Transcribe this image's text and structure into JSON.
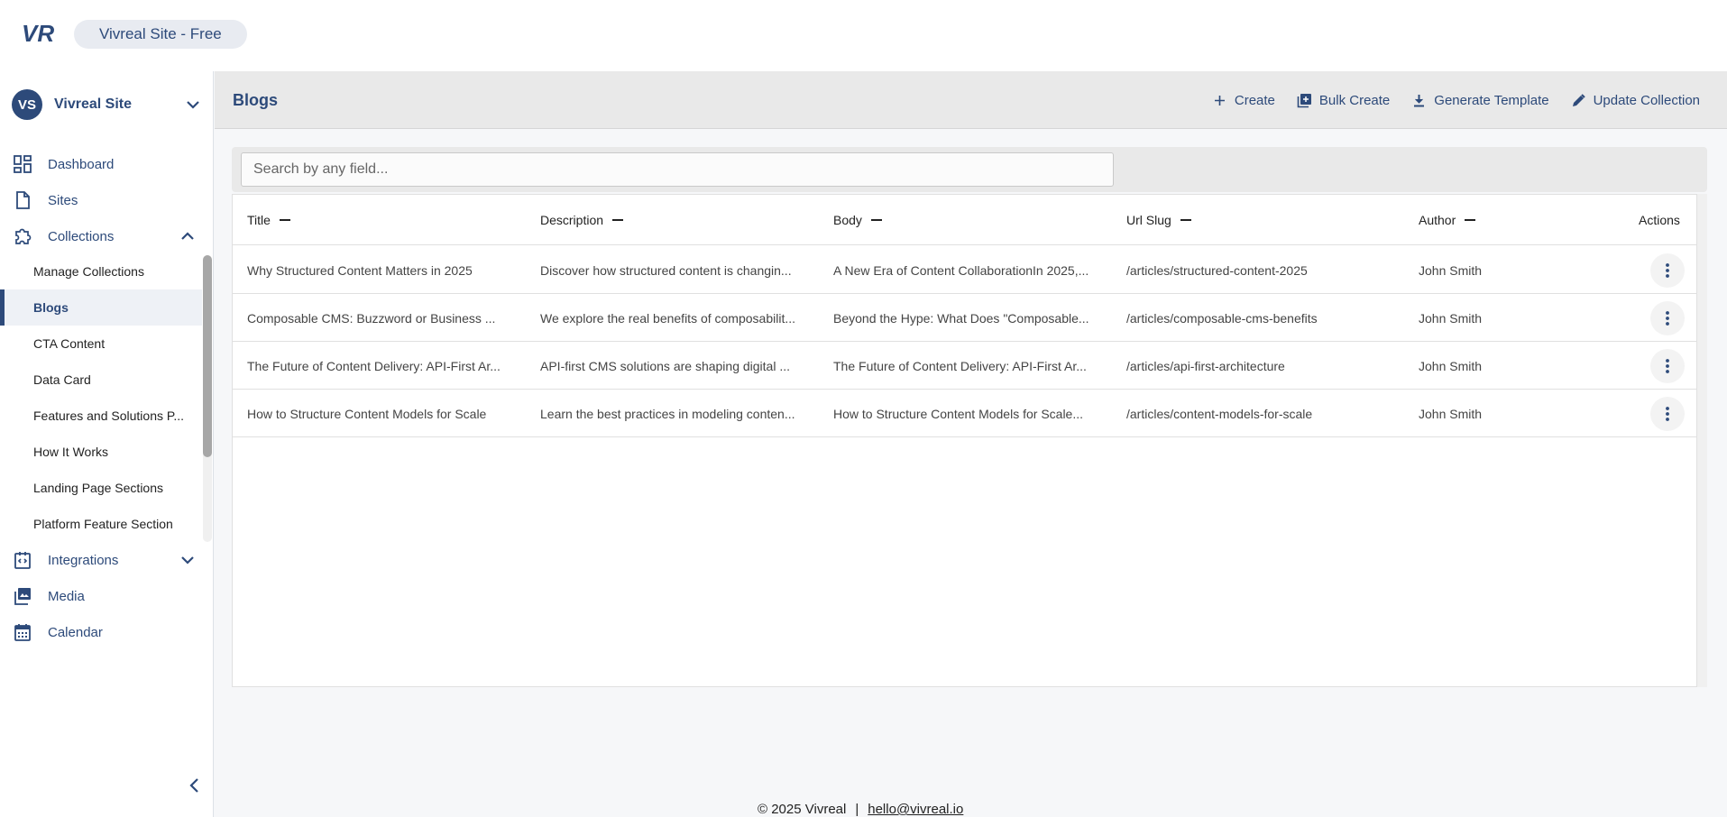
{
  "brand": {
    "logo_text": "VR",
    "site_pill": "Vivreal Site - Free"
  },
  "site_switcher": {
    "initials": "VS",
    "name": "Vivreal Site"
  },
  "nav": {
    "dashboard": "Dashboard",
    "sites": "Sites",
    "collections": "Collections",
    "integrations": "Integrations",
    "media": "Media",
    "calendar": "Calendar"
  },
  "collections_list": [
    "Manage Collections",
    "Blogs",
    "CTA Content",
    "Data Card",
    "Features and Solutions P...",
    "How It Works",
    "Landing Page Sections",
    "Platform Feature Section"
  ],
  "active_collection": "Blogs",
  "page": {
    "title": "Blogs"
  },
  "toolbar": {
    "create": "Create",
    "bulk_create": "Bulk Create",
    "generate_template": "Generate Template",
    "update_collection": "Update Collection"
  },
  "search": {
    "placeholder": "Search by any field...",
    "value": ""
  },
  "table": {
    "columns": [
      "Title",
      "Description",
      "Body",
      "Url Slug",
      "Author",
      "Actions"
    ],
    "rows": [
      [
        "Why Structured Content Matters in 2025",
        "Discover how structured content is changin...",
        "A New Era of Content CollaborationIn 2025,...",
        "/articles/structured-content-2025",
        "John Smith"
      ],
      [
        "Composable CMS: Buzzword or Business ...",
        "We explore the real benefits of composabilit...",
        "Beyond the Hype: What Does \"Composable...",
        "/articles/composable-cms-benefits",
        "John Smith"
      ],
      [
        "The Future of Content Delivery: API-First Ar...",
        "API-first CMS solutions are shaping digital ...",
        "The Future of Content Delivery: API-First Ar...",
        "/articles/api-first-architecture",
        "John Smith"
      ],
      [
        "How to Structure Content Models for Scale",
        "Learn the best practices in modeling conten...",
        "How to Structure Content Models for Scale...",
        "/articles/content-models-for-scale",
        "John Smith"
      ]
    ]
  },
  "footer": {
    "copyright": "© 2025 Vivreal",
    "separator": "|",
    "email": "hello@vivreal.io"
  },
  "colors": {
    "primary": "#2d4a7a",
    "header_bg": "#e9e9e9",
    "page_bg": "#f6f7f9"
  }
}
